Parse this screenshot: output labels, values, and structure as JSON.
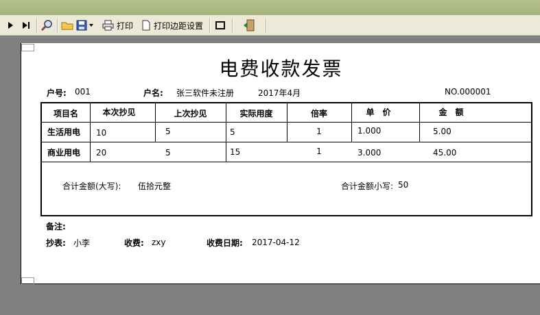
{
  "toolbar": {
    "print_label": "打印",
    "margin_label": "打印边距设置"
  },
  "invoice": {
    "title": "电费收款发票",
    "household_no_label": "户号:",
    "household_no": "001",
    "household_name_label": "户名:",
    "household_name": "张三软件未注册",
    "period": "2017年4月",
    "invoice_no": "NO.000001",
    "columns": [
      "项目名",
      "本次抄见",
      "上次抄见",
      "实际用度",
      "倍率",
      "单　价",
      "金　额"
    ],
    "rows": [
      {
        "name": "生活用电",
        "current": "10",
        "previous": "5",
        "usage": "5",
        "rate": "1",
        "price": "1.000",
        "amount": "5.00"
      },
      {
        "name": "商业用电",
        "current": "20",
        "previous": "5",
        "usage": "15",
        "rate": "1",
        "price": "3.000",
        "amount": "45.00"
      }
    ],
    "total_upper_label": "合计金额(大写):",
    "total_upper": "伍拾元整",
    "total_lower_label": "合计金额小写:",
    "total_lower": "50",
    "remark_label": "备注:",
    "reader_label": "抄表:",
    "reader": "小李",
    "collector_label": "收费:",
    "collector": "zxy",
    "date_label": "收费日期:",
    "date": "2017-04-12"
  }
}
